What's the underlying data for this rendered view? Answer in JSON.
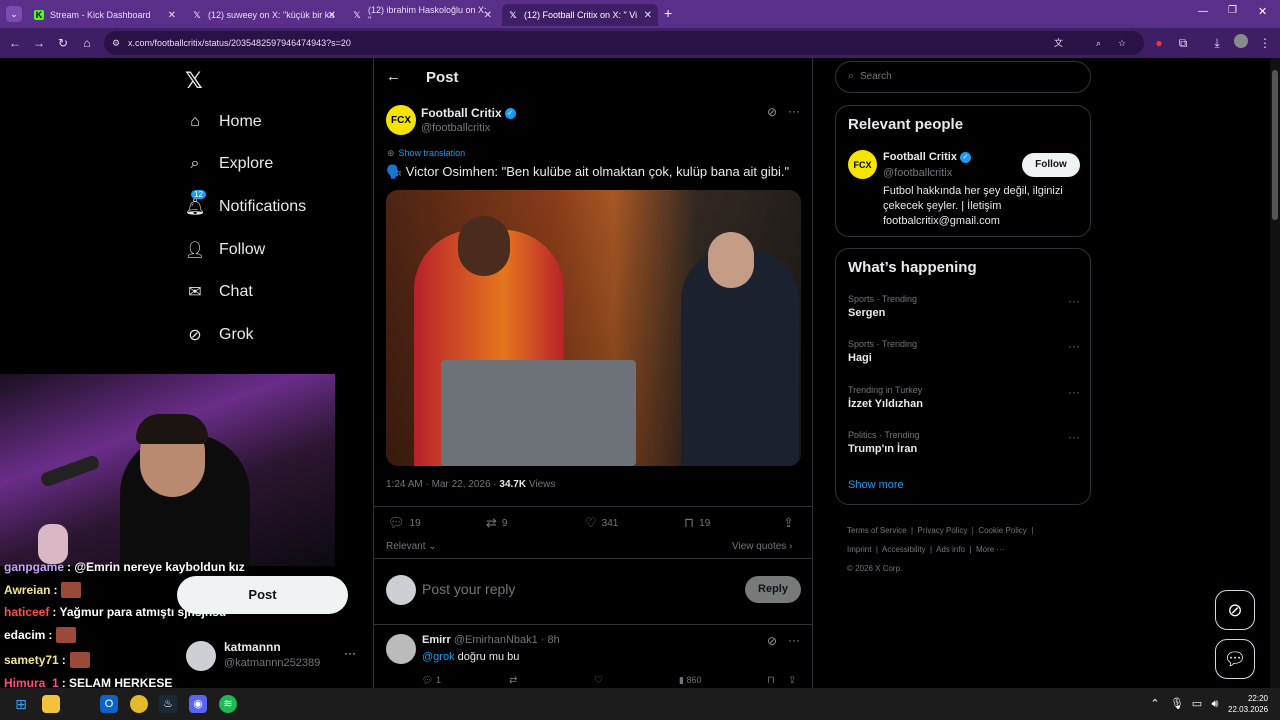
{
  "browser": {
    "tabs": [
      {
        "title": "Stream - Kick Dashboard",
        "favicon": "kick-icon",
        "active": false
      },
      {
        "title": "(12) suweey on X: \"küçük bir ka",
        "favicon": "x-icon",
        "active": false
      },
      {
        "title": "(12) ibrahim Haskoloğlu on X: \"",
        "favicon": "x-icon",
        "active": false
      },
      {
        "title": "(12) Football Critix on X: \" Vi",
        "favicon": "x-icon",
        "active": true
      }
    ],
    "url": "x.com/footballcritix/status/2035482597946474943?s=20"
  },
  "sidebar": {
    "items": [
      {
        "label": "Home",
        "icon": "home-icon"
      },
      {
        "label": "Explore",
        "icon": "search-icon"
      },
      {
        "label": "Notifications",
        "icon": "bell-icon",
        "badge": "12"
      },
      {
        "label": "Follow",
        "icon": "add-user-icon"
      },
      {
        "label": "Chat",
        "icon": "mail-icon"
      },
      {
        "label": "Grok",
        "icon": "grok-icon"
      }
    ],
    "post_label": "Post",
    "account": {
      "name": "katmannn",
      "handle": "@katmannn252389"
    }
  },
  "stream_chat": [
    {
      "user": "ganpgame",
      "text": ": @Emrin nereye kayboldun kız",
      "color": "#c9a3ff"
    },
    {
      "user": "Awreian",
      "text": ":",
      "color": "#f0e68c",
      "emote": true
    },
    {
      "user": "haticeef",
      "text": ": Yağmur para atmıştı sjnsjnsd",
      "color": "#ff4d4d"
    },
    {
      "user": "edacim",
      "text": ":",
      "color": "#ffffff",
      "emote": true
    },
    {
      "user": "samety71",
      "text": ":",
      "color": "#f0e68c",
      "emote": true
    },
    {
      "user": "Himura_1",
      "text": ": SELAM HERKESE",
      "color": "#ff4d7a"
    }
  ],
  "post": {
    "header": "Post",
    "author": "Football Critix",
    "handle": "@footballcritix",
    "avatar_text": "FCX",
    "show_translation": "Show translation",
    "text": "🗣️ Victor Osimhen: \"Ben kulübe ait olmaktan çok, kulüp bana ait gibi.\"",
    "time": "1:24 AM · Mar 22, 2026 · ",
    "views_count": "34.7K",
    "views_label": " Views",
    "stats": {
      "replies": "19",
      "reposts": "9",
      "likes": "341",
      "bookmarks": "19"
    },
    "sort_label": "Relevant",
    "view_quotes": "View quotes",
    "reply_placeholder": "Post your reply",
    "reply_button": "Reply"
  },
  "reply": {
    "author": "Emirr",
    "handle": "@EmirhanNbak1 · 8h",
    "mention": "@grok",
    "text": " doğru mu bu",
    "replies": "1",
    "views": "860"
  },
  "right": {
    "search_placeholder": "Search",
    "relevant_title": "Relevant people",
    "person": {
      "name": "Football Critix",
      "handle": "@footballcritix",
      "bio": "Futbol hakkında her şey değil, ilginizi çekecek şeyler. | İletişim footbalcritix@gmail.com",
      "follow_label": "Follow"
    },
    "happening_title": "What’s happening",
    "trends": [
      {
        "category": "Sports · Trending",
        "name": "Sergen"
      },
      {
        "category": "Sports · Trending",
        "name": "Hagi"
      },
      {
        "category": "Trending in Turkey",
        "name": "İzzet Yıldızhan"
      },
      {
        "category": "Politics · Trending",
        "name": "Trump'ın İran"
      }
    ],
    "show_more": "Show more",
    "footer": [
      "Terms of Service",
      "Privacy Policy",
      "Cookie Policy",
      "Imprint",
      "Accessibility",
      "Ads info",
      "More ···",
      "© 2026 X Corp."
    ]
  },
  "taskbar": {
    "time": "22:20",
    "date": "22.03.2026"
  }
}
